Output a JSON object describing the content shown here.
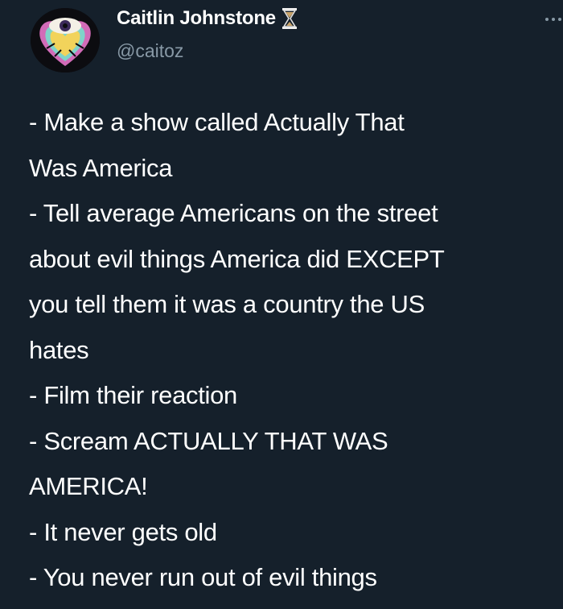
{
  "user": {
    "display_name": "Caitlin Johnstone",
    "handle": "@caitoz",
    "badge_icon": "hourglass-icon",
    "avatar_icon": "eye-heart-avatar"
  },
  "menu_icon": "more-horizontal-icon",
  "tweet": {
    "lines": [
      "- Make a show called Actually That",
      "Was America",
      "- Tell average Americans on the street",
      "about evil things America did EXCEPT",
      "you tell them it was a country the US",
      "hates",
      "- Film their reaction",
      "- Scream ACTUALLY THAT WAS",
      "AMERICA!",
      "- It never gets old",
      "- You never run out of evil things"
    ]
  },
  "colors": {
    "background": "#15202b",
    "text": "#ffffff",
    "secondary_text": "#8899a6"
  }
}
